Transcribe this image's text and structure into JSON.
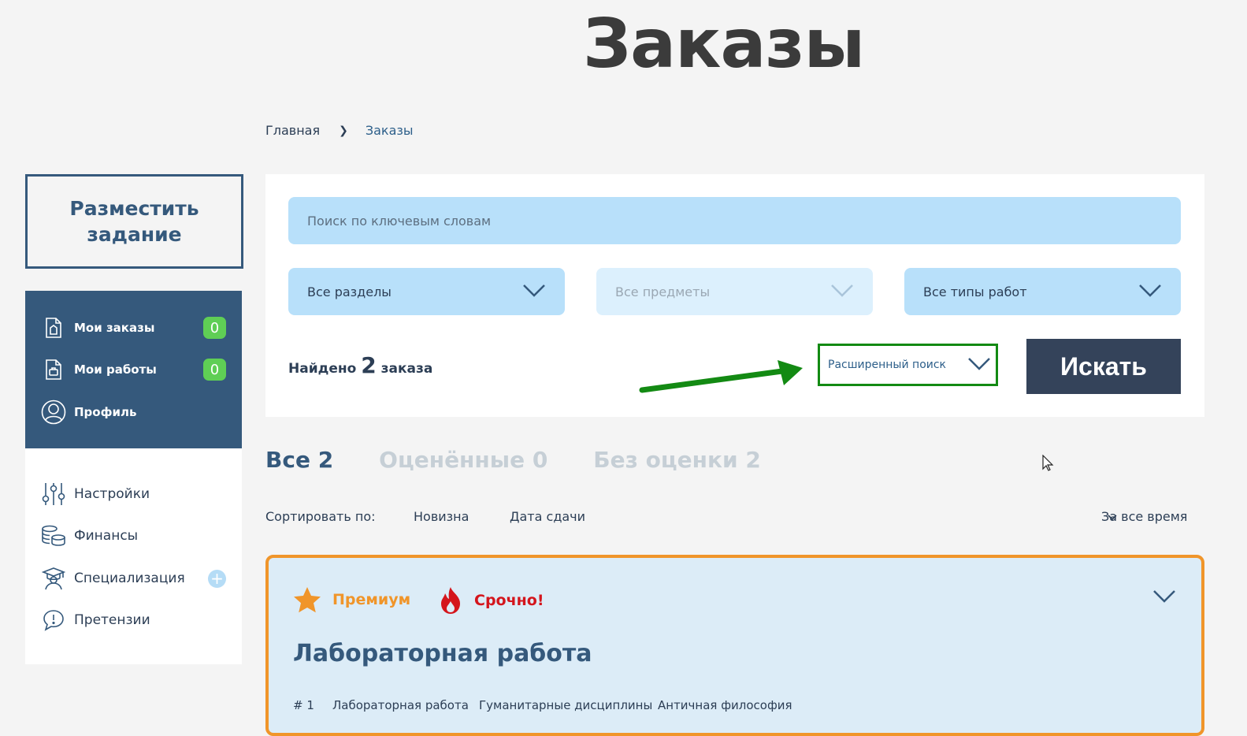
{
  "header": {
    "title": "Заказы"
  },
  "breadcrumb": {
    "home": "Главная",
    "current": "Заказы"
  },
  "sidebar": {
    "post_task": "Разместить задание",
    "primary": [
      {
        "label": "Мои заказы",
        "badge": "0",
        "icon": "document-building-icon"
      },
      {
        "label": "Мои работы",
        "badge": "0",
        "icon": "document-briefcase-icon"
      },
      {
        "label": "Профиль",
        "icon": "user-circle-icon"
      }
    ],
    "secondary": [
      {
        "label": "Настройки",
        "icon": "sliders-icon"
      },
      {
        "label": "Финансы",
        "icon": "coins-icon"
      },
      {
        "label": "Специализация",
        "icon": "graduate-icon"
      },
      {
        "label": "Претензии",
        "icon": "speech-alert-icon"
      }
    ]
  },
  "search": {
    "placeholder": "Поиск по ключевым словам",
    "section": "Все разделы",
    "subject": "Все предметы",
    "work_type": "Все типы работ",
    "found_prefix": "Найдено",
    "found_count": "2",
    "found_suffix": "заказа",
    "advanced": "Расширенный поиск",
    "submit": "Искать"
  },
  "tabs": [
    {
      "label": "Все",
      "count": "2",
      "active": true
    },
    {
      "label": "Оценённые",
      "count": "0",
      "active": false
    },
    {
      "label": "Без оценки",
      "count": "2",
      "active": false
    }
  ],
  "sort": {
    "label": "Сортировать по:",
    "options": [
      "Новизна",
      "Дата сдачи"
    ],
    "period": "За все время"
  },
  "order": {
    "tags": [
      {
        "label": "Премиум",
        "color": "#f0952a",
        "icon": "star-icon"
      },
      {
        "label": "Срочно!",
        "color": "#d4151c",
        "icon": "flame-icon"
      }
    ],
    "title": "Лабораторная работа",
    "meta": [
      "# 1",
      "Лабораторная работа",
      "Гуманитарные дисциплины",
      "Античная философия"
    ]
  },
  "colors": {
    "primary": "#35597c",
    "accent": "#f0952a",
    "input_bg": "#b8e0fa",
    "highlight": "#138a13",
    "badge": "#5fce55"
  }
}
